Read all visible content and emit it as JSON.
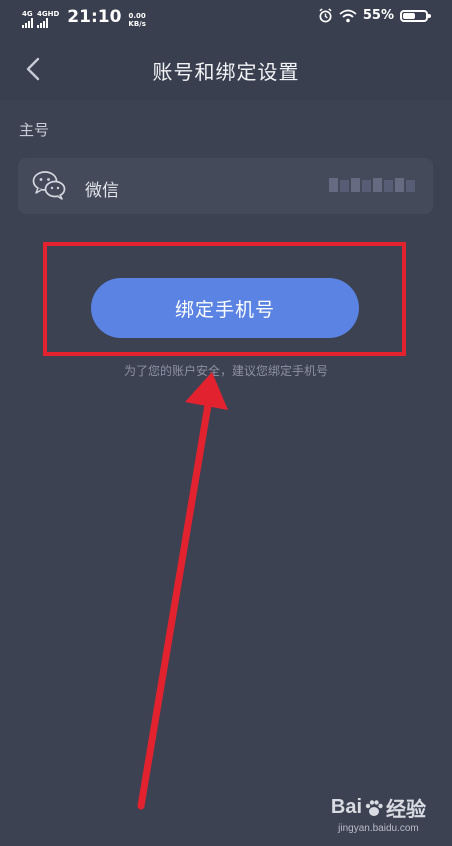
{
  "status_bar": {
    "network_1": "4G",
    "network_2": "4GHD",
    "time": "21:10",
    "speed_value": "0.00",
    "speed_unit": "KB/s",
    "battery_percent": "55%",
    "battery_level": 0.55
  },
  "nav": {
    "title": "账号和绑定设置",
    "back_icon": "chevron-left-icon"
  },
  "section": {
    "primary_label": "主号"
  },
  "account": {
    "name": "微信",
    "icon": "wechat-icon"
  },
  "bind_button": {
    "label": "绑定手机号"
  },
  "hint": {
    "text": "为了您的账户安全，建议您绑定手机号"
  },
  "annotation": {
    "highlight_color": "#e2232f",
    "arrow_color": "#e2232f"
  },
  "watermark": {
    "brand": "Bai",
    "brand_suffix": "经验",
    "url": "jingyan.baidu.com"
  },
  "colors": {
    "background": "#3d4252",
    "card": "#454a5a",
    "button": "#5a83e3"
  }
}
